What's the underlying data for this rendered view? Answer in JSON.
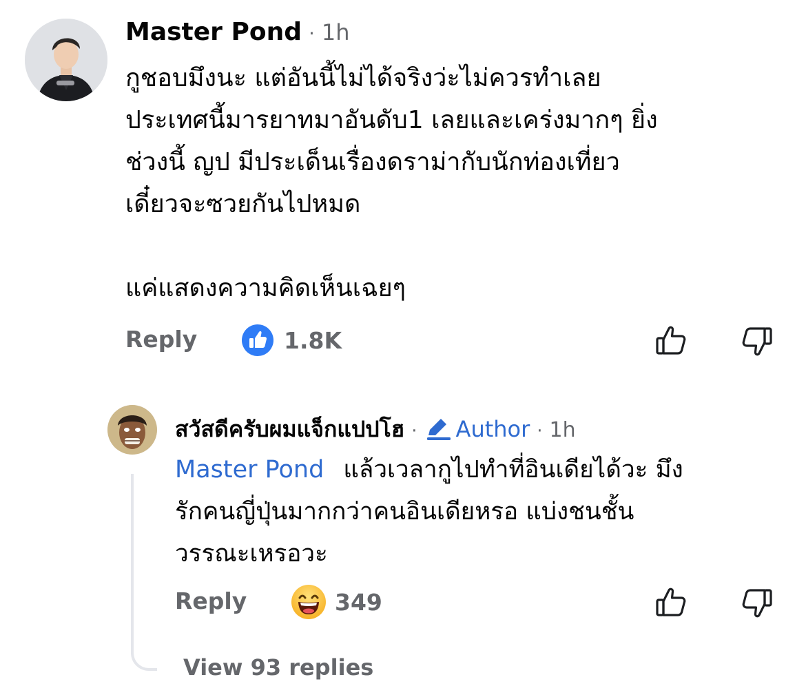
{
  "comment": {
    "author": "Master Pond",
    "separator": "·",
    "time": "1h",
    "lines": [
      "กูชอบมึงนะ แต่อันนี้ไม่ได้จริงว่ะไม่ควรทำเลย",
      "ประเทศนี้มารยาทมาอันดับ1 เลยและเคร่งมากๆ ยิ่ง",
      "ช่วงนี้ ญป มีประเด็นเรื่องดราม่ากับนักท่องเที่ยว",
      "เดี๋ยวจะซวยกันไปหมด",
      "แค่แสดงความคิดเห็นเฉยๆ"
    ],
    "reply_label": "Reply",
    "reaction": {
      "icon": "like-reaction-icon",
      "count": "1.8K"
    }
  },
  "reply": {
    "author": "สวัสดีครับผมแจ็กแปปโฮ",
    "separator": "·",
    "badge": {
      "icon": "pencil-icon",
      "label": "Author"
    },
    "separator2": "·",
    "time": "1h",
    "mention": "Master Pond",
    "lines": [
      "แล้วเวลากูไปทำที่อินเดียได้วะ มึง",
      "รักคนญี่ปุ่นมากกว่าคนอินเดียหรอ แบ่งชนชั้น",
      "วรรณะเหรอวะ"
    ],
    "reply_label": "Reply",
    "reaction": {
      "icon": "haha-reaction-icon",
      "count": "349"
    }
  },
  "view_replies": "View 93 replies",
  "colors": {
    "text": "#050505",
    "muted": "#65676b",
    "mention": "#2f6bd0",
    "like_blue": "#2f7cf6",
    "thread_line": "#e4e6eb"
  }
}
